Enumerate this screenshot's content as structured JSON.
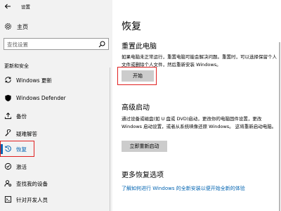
{
  "window": {
    "title": "设置"
  },
  "sidebar": {
    "home_label": "主页",
    "search": {
      "placeholder": "查找设置"
    },
    "section_label": "更新和安全",
    "items": [
      {
        "label": "Windows 更新",
        "icon": "sync-icon",
        "selected": false
      },
      {
        "label": "Windows Defender",
        "icon": "shield-icon",
        "selected": false
      },
      {
        "label": "备份",
        "icon": "upload-icon",
        "selected": false
      },
      {
        "label": "疑难解答",
        "icon": "wrench-icon",
        "selected": false
      },
      {
        "label": "恢复",
        "icon": "history-icon",
        "selected": true
      },
      {
        "label": "激活",
        "icon": "check-circle-icon",
        "selected": false
      },
      {
        "label": "查找我的设备",
        "icon": "person-locate-icon",
        "selected": false
      },
      {
        "label": "针对开发人员",
        "icon": "developer-icon",
        "selected": false
      }
    ]
  },
  "main": {
    "title": "恢复",
    "reset": {
      "heading": "重置此电脑",
      "description": "如果电脑未正常运行，重置电脑可能会解决问题。重置时，可以选择保留个人文件或删除个人文件，然后重新安装 Windows。",
      "button_label": "开始"
    },
    "advanced": {
      "heading": "高级启动",
      "description": "通过设备或磁盘(如 U 盘或 DVD)启动，更改你的电脑固件设置，更改 Windows 启动设置，或者从系统映像还原 Windows。 这将重新启动电脑。",
      "button_label": "立即重新启动"
    },
    "more": {
      "heading": "更多恢复选项",
      "link_label": "了解如何进行 Windows 的全新安装以便开始全新的体验"
    }
  },
  "colors": {
    "accent": "#0063b1",
    "highlight_box": "#e02020",
    "sidebar_bg": "#f2f2f2",
    "button_bg": "#cccccc"
  }
}
